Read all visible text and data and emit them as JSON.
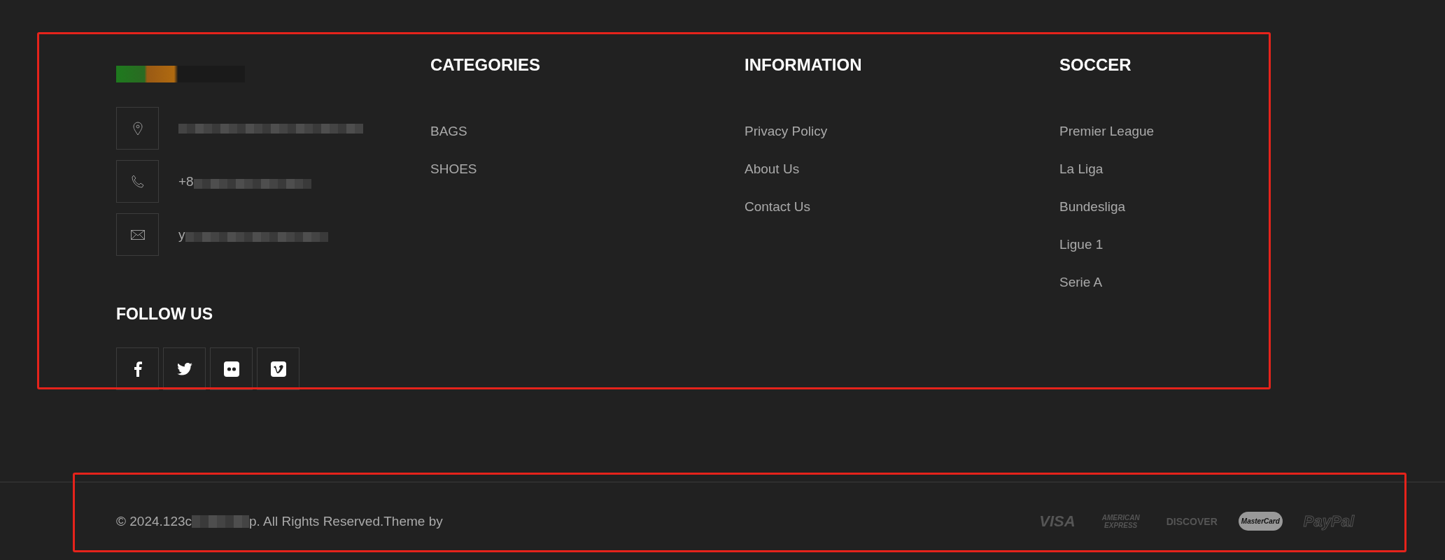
{
  "contact": {
    "items": [
      {
        "kind": "location"
      },
      {
        "kind": "phone",
        "visible_text": "+8"
      },
      {
        "kind": "email",
        "visible_text": "y"
      }
    ]
  },
  "follow": {
    "title": "FOLLOW US",
    "networks": [
      {
        "kind": "facebook"
      },
      {
        "kind": "twitter"
      },
      {
        "kind": "flickr"
      },
      {
        "kind": "vimeo"
      }
    ]
  },
  "columns": [
    {
      "title": "CATEGORIES",
      "links": [
        "BAGS",
        "SHOES"
      ]
    },
    {
      "title": "INFORMATION",
      "links": [
        "Privacy Policy",
        "About Us",
        "Contact Us"
      ]
    },
    {
      "title": "SOCCER",
      "links": [
        "Premier League",
        "La Liga",
        "Bundesliga",
        "Ligue 1",
        "Serie A"
      ]
    }
  ],
  "copyright": {
    "before": "© 2024.123c",
    "after": "p. All Rights Reserved.Theme by"
  },
  "payments": [
    {
      "kind": "visa",
      "label": "VISA"
    },
    {
      "kind": "amex",
      "label": "AMERICAN EXPRESS"
    },
    {
      "kind": "discover",
      "label": "DISCOVER"
    },
    {
      "kind": "mastercard",
      "label": "MasterCard"
    },
    {
      "kind": "paypal",
      "label": "PayPal"
    }
  ]
}
